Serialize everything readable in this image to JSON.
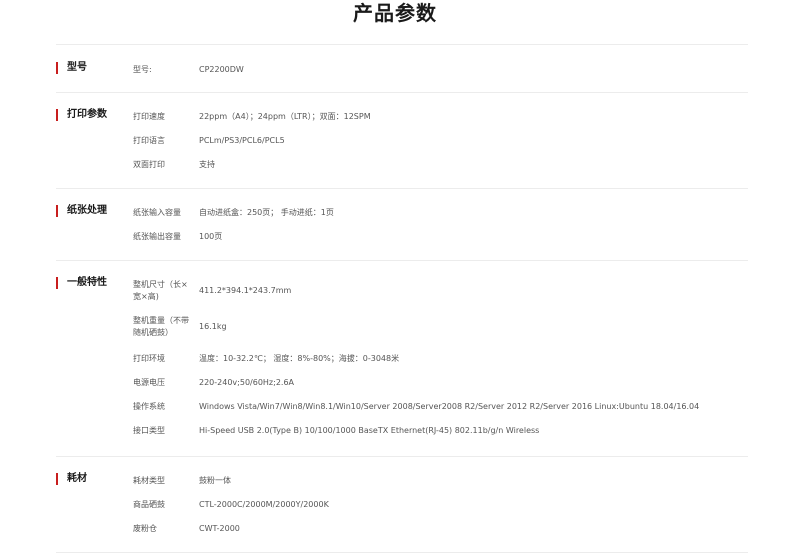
{
  "page_title": "产品参数",
  "colors": {
    "accent": "#c81e1e",
    "divider": "#ececec"
  },
  "sections": [
    {
      "label": "型号",
      "rows": [
        {
          "key": "型号:",
          "value": "CP2200DW"
        }
      ]
    },
    {
      "label": "打印参数",
      "rows": [
        {
          "key": "打印速度",
          "value": "22ppm（A4）；24ppm（LTR）；双面：12SPM"
        },
        {
          "key": "打印语言",
          "value": "PCLm/PS3/PCL6/PCL5"
        },
        {
          "key": "双面打印",
          "value": "支持"
        }
      ]
    },
    {
      "label": "纸张处理",
      "rows": [
        {
          "key": "纸张输入容量",
          "value": "自动进纸盒：250页； 手动进纸：1页"
        },
        {
          "key": "纸张输出容量",
          "value": "100页"
        }
      ]
    },
    {
      "label": "一般特性",
      "rows": [
        {
          "key": "整机尺寸（长×宽×高)",
          "value": "411.2*394.1*243.7mm"
        },
        {
          "key": "整机重量（不带随机硒鼓）",
          "value": "16.1kg"
        },
        {
          "key": "打印环境",
          "value": "温度：10-32.2℃； 湿度：8%-80%；海拔：0-3048米"
        },
        {
          "key": "电源电压",
          "value": "220-240v;50/60Hz;2.6A"
        },
        {
          "key": "操作系统",
          "value": "Windows Vista/Win7/Win8/Win8.1/Win10/Server 2008/Server2008 R2/Server 2012 R2/Server 2016 Linux:Ubuntu 18.04/16.04"
        },
        {
          "key": "接口类型",
          "value": "Hi-Speed USB 2.0(Type B) 10/100/1000 BaseTX Ethernet(RJ-45) 802.11b/g/n Wireless"
        }
      ]
    },
    {
      "label": "耗材",
      "rows": [
        {
          "key": "耗材类型",
          "value": "鼓粉一体"
        },
        {
          "key": "商品硒鼓",
          "value": "CTL-2000C/2000M/2000Y/2000K"
        },
        {
          "key": "废粉仓",
          "value": "CWT-2000"
        }
      ]
    }
  ]
}
